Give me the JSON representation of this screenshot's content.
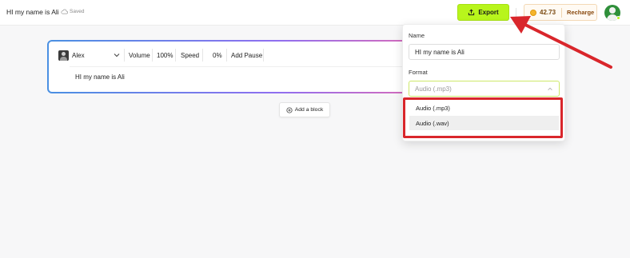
{
  "header": {
    "doc_title": "HI my name is Ali",
    "saved_label": "Saved",
    "export_label": "Export",
    "credits": "42.73",
    "recharge_label": "Recharge"
  },
  "block": {
    "voice_name": "Alex",
    "volume_label": "Volume",
    "volume_value": "100%",
    "speed_label": "Speed",
    "speed_value": "0%",
    "pause_label": "Add Pause",
    "text": "HI my name is Ali"
  },
  "add_block_label": "Add a block",
  "export_panel": {
    "name_label": "Name",
    "name_value": "HI my name is Ali",
    "format_label": "Format",
    "format_selected": "Audio (.mp3)",
    "options": [
      {
        "label": "Audio (.mp3)"
      },
      {
        "label": "Audio (.wav)"
      }
    ]
  },
  "colors": {
    "accent_green": "#b8f51c",
    "annotation_red": "#d9262b",
    "block_gradient": [
      "#4a90e2",
      "#8f6ff0",
      "#f06aa8"
    ]
  },
  "icons": {
    "saved": "cloud-icon",
    "export": "upload-icon",
    "credits": "coin-icon",
    "add_block": "plus-circle-icon",
    "voice_dropdown": "chevron-down-icon",
    "format_dropdown": "chevron-up-icon"
  }
}
